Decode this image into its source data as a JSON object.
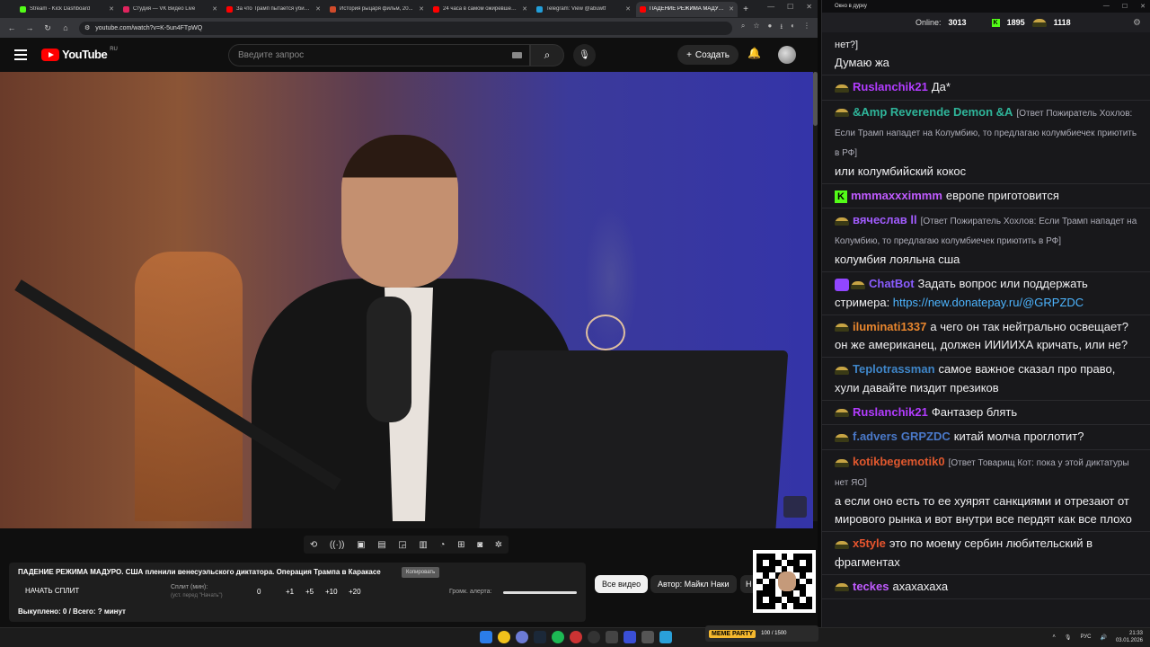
{
  "browser": {
    "tabs": [
      {
        "title": "Stream - Kick Dashboard",
        "color": "#53fc18",
        "active": false
      },
      {
        "title": "Студия — VK Видео Live",
        "color": "#e0245e",
        "active": false
      },
      {
        "title": "За что Трамп пытается убить...",
        "color": "#ff0000",
        "active": false
      },
      {
        "title": "История рыцаря фильм, 20...",
        "color": "#d14b2b",
        "active": false
      },
      {
        "title": "24 часа в самом ожиревшем...",
        "color": "#ff0000",
        "active": false
      },
      {
        "title": "Telegram: View @abuwtf",
        "color": "#229ed9",
        "active": false
      },
      {
        "title": "ПАДЕНИЕ РЕЖИМА МАДУРО...",
        "color": "#ff0000",
        "active": true
      }
    ],
    "new_tab": "+",
    "url": "youtube.com/watch?v=K-5un4FTpWQ"
  },
  "youtube": {
    "logo_text": "YouTube",
    "region": "RU",
    "search_placeholder": "Введите запрос",
    "create_label": "Создать"
  },
  "panel": {
    "video_title": "ПАДЕНИЕ РЕЖИМА МАДУРО. США пленили венесуэльского диктатора. Операция Трампа в Каракасе",
    "copy_label": "Копировать",
    "start_split": "НАЧАТЬ СПЛИТ",
    "split_label": "Сплит (мин):",
    "split_hint": "(уст. перед \"Начать\")",
    "split_value": "0",
    "increments": [
      "+1",
      "+5",
      "+10",
      "+20"
    ],
    "alert_label": "Громк. алерта:",
    "alert_level": 1.0,
    "bought": "Выкуплено: 0 / Всего: ? минут"
  },
  "chips": {
    "all": "Все видео",
    "author": "Автор: Майкл Наки",
    "more": "Н"
  },
  "chat": {
    "window_title": "Окно в дурку",
    "online_label": "Online:",
    "online_count": "3013",
    "kick_count": "1895",
    "hat_count": "1118",
    "messages": [
      {
        "user": "",
        "color": "#efeff1",
        "reply": "нет?]",
        "text": "Думаю жа",
        "badge": "none"
      },
      {
        "user": "Ruslanchik21",
        "color": "#b23cff",
        "reply": "",
        "text": "Да*",
        "badge": "hat"
      },
      {
        "user": "&Amp Reverende Demon &A",
        "color": "#2fb59a",
        "reply": "[Ответ Пожиратель Хохлов: Если Трамп нападет на Колумбию, то предлагаю колумбиечек приютить в РФ]",
        "text": "или колумбийский кокос",
        "badge": "hat"
      },
      {
        "user": "mmmaxxximmm",
        "color": "#c05bff",
        "reply": "",
        "text": "европе приготовится",
        "badge": "kick"
      },
      {
        "user": "вячеслав ll",
        "color": "#a25cff",
        "reply": "[Ответ Пожиратель Хохлов: Если Трамп нападет на Колумбию, то предлагаю колумбиечек приютить в РФ]",
        "text": "колумбия лояльна сша",
        "badge": "hat"
      },
      {
        "user": "ChatBot",
        "color": "#8a5cff",
        "reply": "",
        "text": "Задать вопрос или поддержать стримера: ",
        "link": "https://new.donatepay.ru/@GRPZDC",
        "badge": "bot"
      },
      {
        "user": "iluminati1337",
        "color": "#e8862e",
        "reply": "",
        "text": "а чего он так нейтрально освещает? он же американец, должен ИИИИХА кричать, или не?",
        "badge": "hat"
      },
      {
        "user": "Teplotrassman",
        "color": "#3f86c9",
        "reply": "",
        "text": "самое важное сказал про право, хули давайте пиздит презиков",
        "badge": "hat"
      },
      {
        "user": "Ruslanchik21",
        "color": "#b23cff",
        "reply": "",
        "text": "Фантазер блять",
        "badge": "hat"
      },
      {
        "user": "f.advers",
        "color": "#4a79c9",
        "mention": "GRPZDC",
        "reply": "",
        "text": "китай молча проглотит?",
        "badge": "hat"
      },
      {
        "user": "kotikbegemotik0",
        "color": "#e0582e",
        "reply": "[Ответ Товарищ Кот: пока у этой диктатуры нет ЯО]",
        "text": "а если оно есть то ее хуярят санкциями и отрезают от мирового рынка и вот внутри все пердят как все плохо",
        "badge": "hat"
      },
      {
        "user": "x5tyle",
        "color": "#e8552e",
        "reply": "",
        "text": "это по моему сербин любительский в фрагментах",
        "badge": "hat"
      },
      {
        "user": "teckes",
        "color": "#c05bff",
        "reply": "",
        "text": "ахахахаха",
        "badge": "hat"
      }
    ]
  },
  "taskbar": {
    "meme_label": "MEME PARTY",
    "meme_progress": "100 / 1500",
    "lang": "РУС",
    "time": "21:33",
    "date": "03.01.2026"
  }
}
